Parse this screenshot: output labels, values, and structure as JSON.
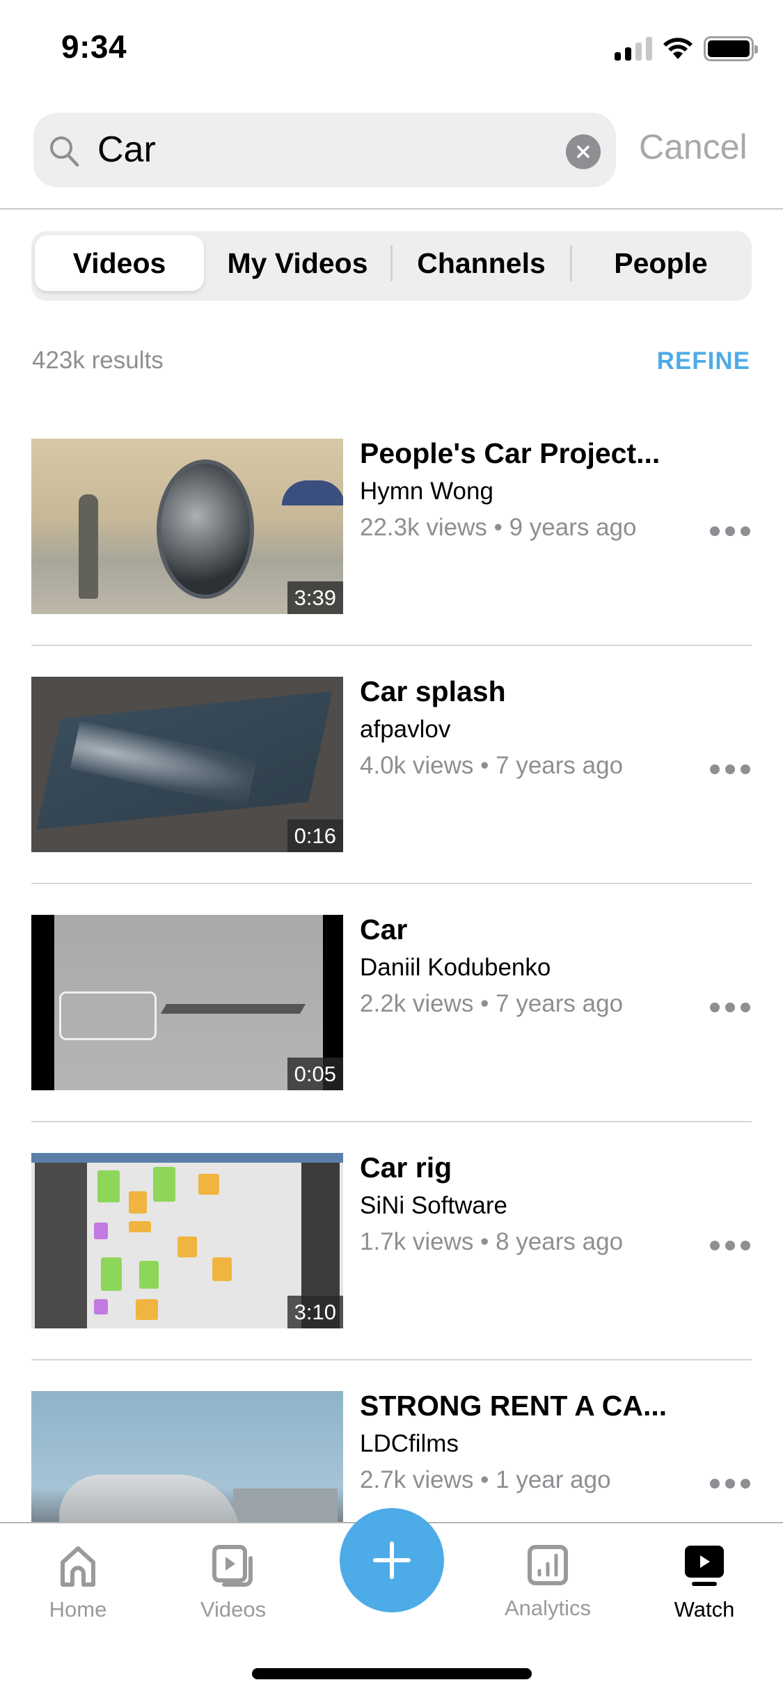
{
  "status_bar": {
    "time": "9:34",
    "signal_bars_active": 2,
    "signal_bars_total": 4,
    "icons": [
      "cellular-signal-icon",
      "wifi-icon",
      "battery-icon"
    ]
  },
  "search": {
    "value": "Car",
    "placeholder": "Search",
    "icon": "search-icon",
    "clear_icon": "clear-icon",
    "cancel_label": "Cancel"
  },
  "segments": {
    "selected": "Videos",
    "items": [
      {
        "label": "Videos"
      },
      {
        "label": "My Videos"
      },
      {
        "label": "Channels"
      },
      {
        "label": "People"
      }
    ]
  },
  "results": {
    "count_label": "423k results",
    "refine_label": "REFINE"
  },
  "videos": [
    {
      "title": "People's Car Project...",
      "channel": "Hymn Wong",
      "views": "22.3k views",
      "age": "9 years ago",
      "separator": "•",
      "duration": "3:39"
    },
    {
      "title": "Car splash",
      "channel": "afpavlov",
      "views": "4.0k views",
      "age": "7 years ago",
      "separator": "•",
      "duration": "0:16"
    },
    {
      "title": "Car",
      "channel": "Daniil Kodubenko",
      "views": "2.2k views",
      "age": "7 years ago",
      "separator": "•",
      "duration": "0:05"
    },
    {
      "title": "Car rig",
      "channel": "SiNi Software",
      "views": "1.7k views",
      "age": "8 years ago",
      "separator": "•",
      "duration": "3:10"
    },
    {
      "title": "STRONG RENT A CA...",
      "channel": "LDCfilms",
      "views": "2.7k views",
      "age": "1 year ago",
      "separator": "•",
      "duration": ""
    }
  ],
  "tabbar": {
    "items": [
      {
        "label": "Home",
        "icon": "home-icon",
        "active": false
      },
      {
        "label": "Videos",
        "icon": "videos-icon",
        "active": false
      },
      {
        "label": "Analytics",
        "icon": "analytics-icon",
        "active": false
      },
      {
        "label": "Watch",
        "icon": "watch-icon",
        "active": true
      }
    ],
    "fab_icon": "plus-icon"
  },
  "colors": {
    "accent": "#4DABE8",
    "secondary_text": "#8e8e93",
    "search_bg": "#eeeeee",
    "inactive_tab": "#9a9a9a"
  }
}
